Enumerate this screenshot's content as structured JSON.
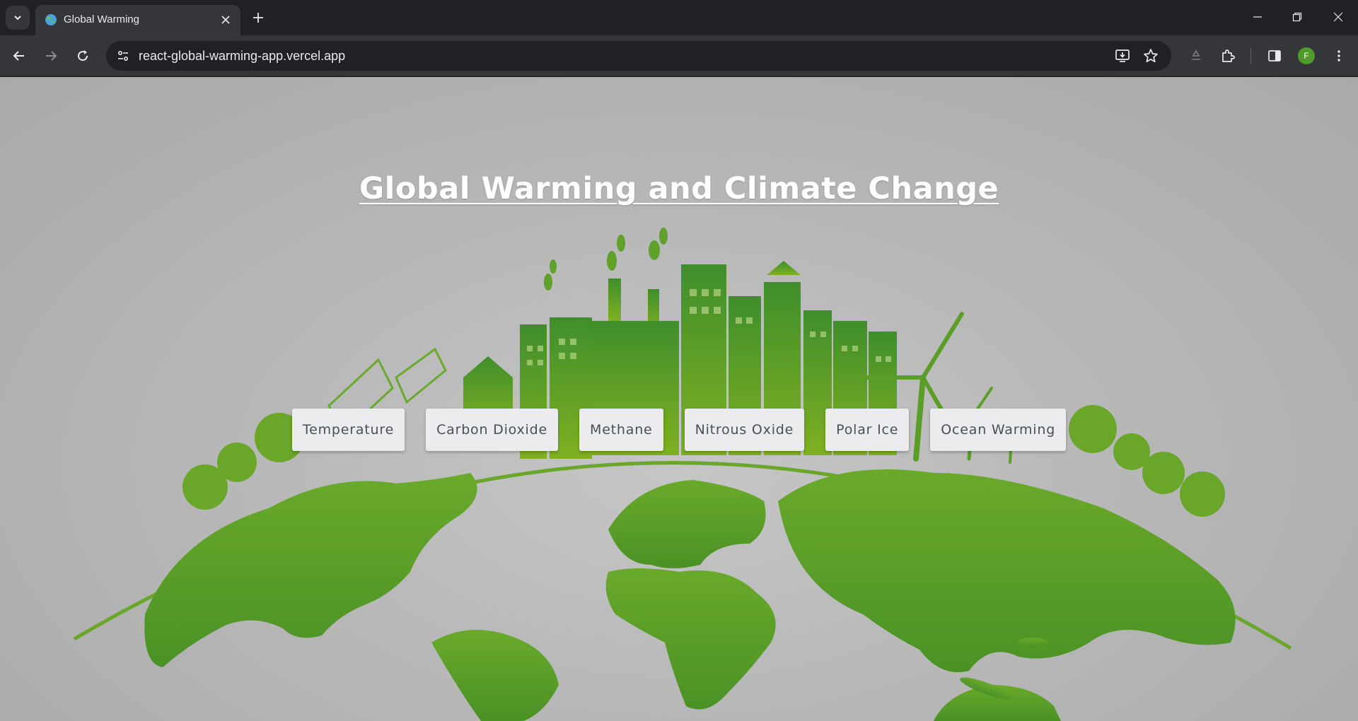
{
  "browser": {
    "tab_title": "Global Warming",
    "url": "react-global-warming-app.vercel.app",
    "avatar_letter": "F"
  },
  "page": {
    "title": "Global Warming and Climate Change",
    "buttons": [
      "Temperature",
      "Carbon Dioxide",
      "Methane",
      "Nitrous Oxide",
      "Polar Ice",
      "Ocean Warming"
    ]
  },
  "colors": {
    "earth_green": "#5fa12a",
    "background_gray": "#bdbdbd",
    "button_bg": "#ececee",
    "button_text": "#4a4f55"
  },
  "icons": [
    "tab-search-icon",
    "globe-favicon-icon",
    "close-icon",
    "plus-icon",
    "minimize-icon",
    "restore-icon",
    "window-close-icon",
    "back-icon",
    "forward-icon",
    "reload-icon",
    "site-info-icon",
    "install-icon",
    "star-icon",
    "recycle-icon",
    "extensions-icon",
    "side-panel-icon",
    "menu-icon"
  ]
}
